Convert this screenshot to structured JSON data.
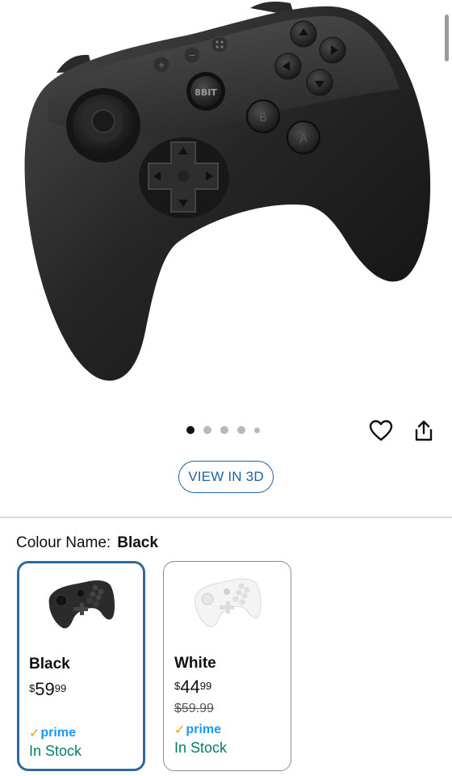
{
  "product_image": {
    "alt": "8BitDo wireless game controller, black",
    "face_buttons": [
      "B",
      "A"
    ],
    "gallery_dots": 5,
    "active_dot": 0
  },
  "actions": {
    "wishlist_icon": "heart-icon",
    "share_icon": "share-icon",
    "view3d_label": "VIEW IN 3D"
  },
  "colour": {
    "label": "Colour Name:",
    "selected": "Black"
  },
  "variants": [
    {
      "name": "Black",
      "price_symbol": "$",
      "price_whole": "59",
      "price_fraction": "99",
      "was_price": "",
      "prime": "prime",
      "stock": "In Stock",
      "controller_color": "#2b2b2b"
    },
    {
      "name": "White",
      "price_symbol": "$",
      "price_whole": "44",
      "price_fraction": "99",
      "was_price": "$59.99",
      "prime": "prime",
      "stock": "In Stock",
      "controller_color": "#f2f2f2"
    }
  ],
  "colors": {
    "accent": "#2162a1",
    "selected_border": "#2c6a9f",
    "prime_blue": "#1a98ff",
    "prime_check": "#ff9900",
    "stock_green": "#067d62"
  }
}
